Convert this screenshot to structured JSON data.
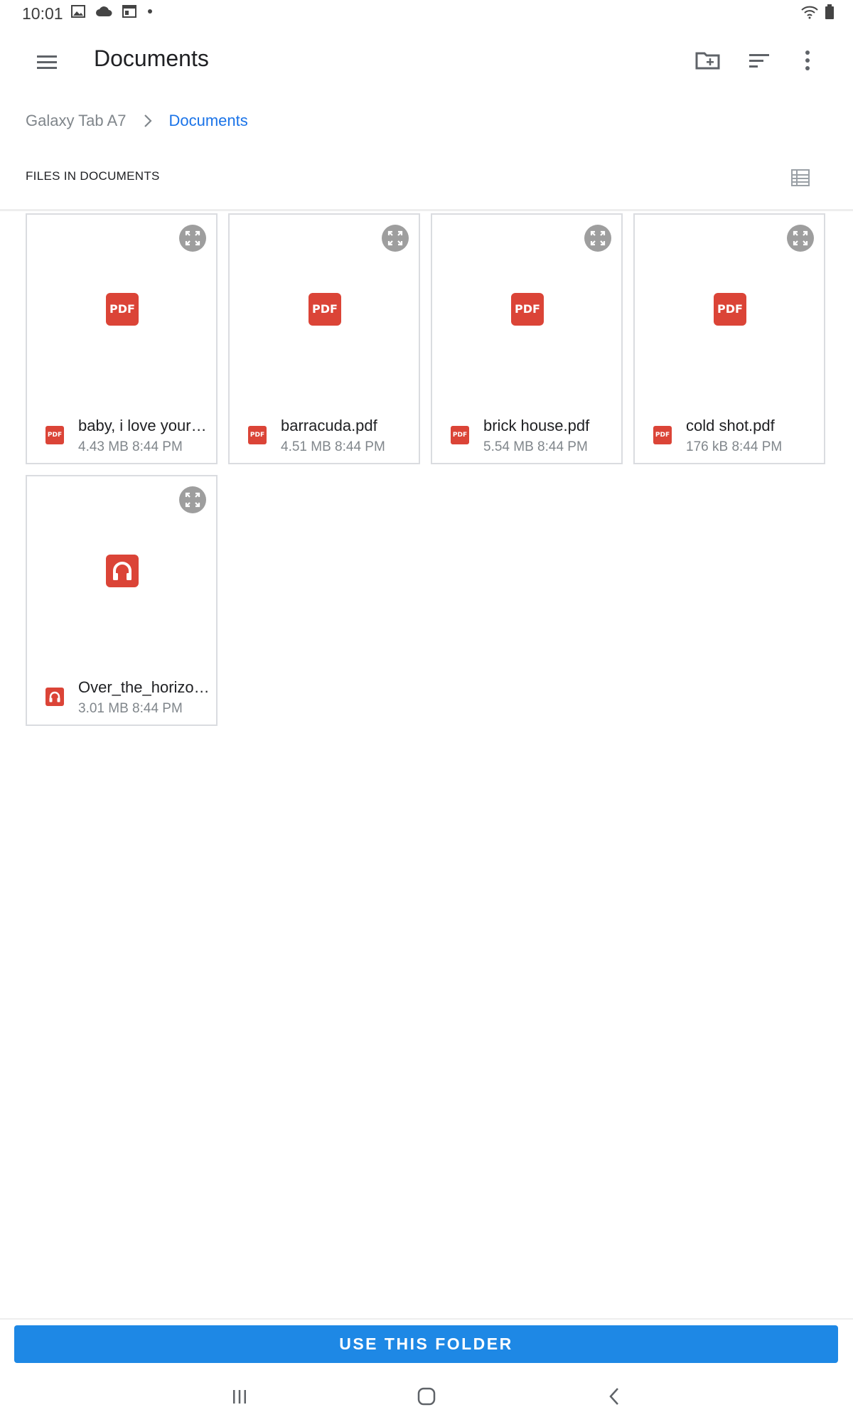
{
  "status_bar": {
    "time": "10:01",
    "icons": [
      "image-icon",
      "cloud-icon",
      "calendar-icon",
      "dot-icon"
    ],
    "right_icons": [
      "wifi-icon",
      "battery-icon"
    ]
  },
  "app_bar": {
    "title": "Documents",
    "actions": [
      "new-folder-icon",
      "sort-icon",
      "more-vert-icon"
    ]
  },
  "breadcrumb": {
    "root": "Galaxy Tab A7",
    "current": "Documents"
  },
  "section": {
    "title": "FILES IN DOCUMENTS"
  },
  "files": [
    {
      "name": "baby, i love your…",
      "size": "4.43 MB",
      "time": "8:44 PM",
      "type": "pdf",
      "thumb_label": "PDF"
    },
    {
      "name": "barracuda.pdf",
      "size": "4.51 MB",
      "time": "8:44 PM",
      "type": "pdf",
      "thumb_label": "PDF"
    },
    {
      "name": "brick house.pdf",
      "size": "5.54 MB",
      "time": "8:44 PM",
      "type": "pdf",
      "thumb_label": "PDF"
    },
    {
      "name": "cold shot.pdf",
      "size": "176 kB",
      "time": "8:44 PM",
      "type": "pdf",
      "thumb_label": "PDF"
    },
    {
      "name": "Over_the_horizo…",
      "size": "3.01 MB",
      "time": "8:44 PM",
      "type": "audio",
      "thumb_label": ""
    }
  ],
  "footer": {
    "button_label": "USE THIS FOLDER"
  },
  "colors": {
    "accent": "#1e88e5",
    "file_icon_red": "#db4437",
    "breadcrumb_active": "#1a73e8"
  }
}
